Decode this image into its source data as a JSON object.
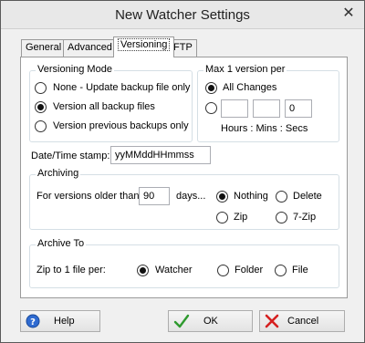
{
  "window": {
    "title": "New Watcher Settings",
    "close_glyph": "✕"
  },
  "tabs": [
    {
      "label": "General"
    },
    {
      "label": "Advanced"
    },
    {
      "label": "Versioning",
      "active": true
    },
    {
      "label": "FTP"
    }
  ],
  "versioning_mode": {
    "title": "Versioning Mode",
    "options": [
      {
        "label": "None - Update backup file only",
        "checked": false
      },
      {
        "label": "Version all backup files",
        "checked": true
      },
      {
        "label": "Version previous backups only",
        "checked": false
      }
    ]
  },
  "max_version": {
    "title": "Max 1 version per",
    "all_changes_label": "All Changes",
    "all_changes_checked": true,
    "interval_checked": false,
    "hours": "",
    "mins": "",
    "secs": "0",
    "units_label": "Hours : Mins : Secs"
  },
  "datetime": {
    "label": "Date/Time stamp:",
    "value": "yyMMddHHmmss"
  },
  "archiving": {
    "title": "Archiving",
    "older_than_label": "For versions older than",
    "days_value": "90",
    "days_label": "days...",
    "options": [
      {
        "label": "Nothing",
        "checked": true
      },
      {
        "label": "Delete",
        "checked": false
      },
      {
        "label": "Zip",
        "checked": false
      },
      {
        "label": "7-Zip",
        "checked": false
      }
    ]
  },
  "archive_to": {
    "title": "Archive To",
    "zip_label": "Zip to 1 file per:",
    "options": [
      {
        "label": "Watcher",
        "checked": true
      },
      {
        "label": "Folder",
        "checked": false
      },
      {
        "label": "File",
        "checked": false
      }
    ]
  },
  "buttons": {
    "help": "Help",
    "ok": "OK",
    "cancel": "Cancel"
  },
  "icons": {
    "help": "help-icon",
    "ok": "check-icon",
    "cancel": "cross-icon"
  },
  "colors": {
    "ok_check": "#2e9a2e",
    "cancel_cross": "#d62020",
    "help_blue": "#2f6bd1"
  }
}
